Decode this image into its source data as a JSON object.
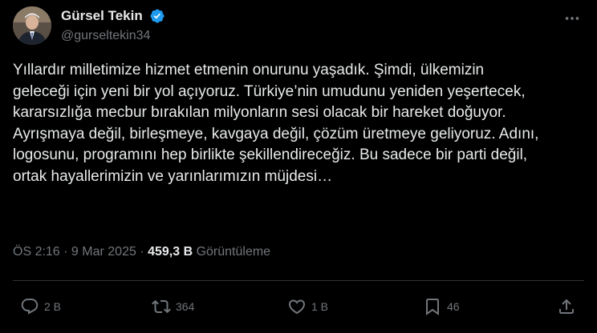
{
  "user": {
    "display_name": "Gürsel Tekin",
    "handle": "@gurseltekin34",
    "verified_icon": "verified-badge-icon"
  },
  "tweet": {
    "text": "Yıllardır milletimize hizmet etmenin onurunu yaşadık. Şimdi, ülkemizin geleceği için yeni bir yol açıyoruz. Türkiye’nin umudunu yeniden yeşertecek, kararsızlığa mecbur bırakılan milyonların sesi olacak bir hareket doğuyor. Ayrışmaya değil, birleşmeye, kavgaya değil, çözüm üretmeye geliyoruz. Adını, logosunu, programını hep birlikte şekillendireceğiz. Bu sadece bir parti değil, ortak hayallerimizin ve yarınlarımızın müjdesi…"
  },
  "meta": {
    "time": "ÖS 2:16",
    "sep1": " · ",
    "date": "9 Mar 2025",
    "sep2": " · ",
    "views_count": "459,3 B",
    "views_label": " Görüntüleme"
  },
  "actions": {
    "replies": "2 B",
    "reposts": "364",
    "likes": "1 B",
    "bookmarks": "46"
  },
  "colors": {
    "background": "#000000",
    "text": "#e7e9ea",
    "secondary": "#71767b",
    "verified": "#1d9bf0",
    "divider": "#2f3336"
  }
}
